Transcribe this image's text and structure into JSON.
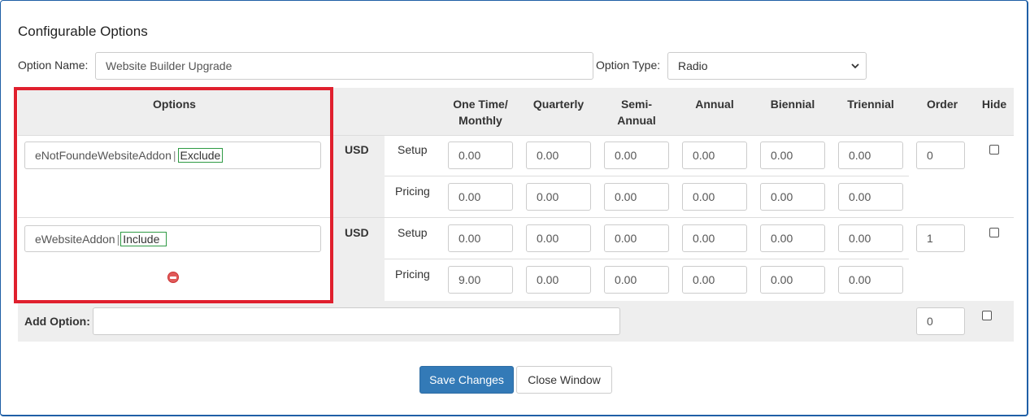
{
  "title": "Configurable Options",
  "option_name": {
    "label": "Option Name:",
    "value": "Website Builder Upgrade"
  },
  "option_type": {
    "label": "Option Type:",
    "value": "Radio"
  },
  "headers": {
    "options": "Options",
    "one_time_l1": "One Time/",
    "one_time_l2": "Monthly",
    "quarterly": "Quarterly",
    "semi_l1": "Semi-",
    "semi_l2": "Annual",
    "annual": "Annual",
    "biennial": "Biennial",
    "triennial": "Triennial",
    "order": "Order",
    "hide": "Hide"
  },
  "rows": [
    {
      "name_prefix": "eNotFoundeWebsiteAddon",
      "name_suffix": "Exclude",
      "currency": "USD",
      "setup_label": "Setup",
      "pricing_label": "Pricing",
      "setup": [
        "0.00",
        "0.00",
        "0.00",
        "0.00",
        "0.00",
        "0.00"
      ],
      "pricing": [
        "0.00",
        "0.00",
        "0.00",
        "0.00",
        "0.00",
        "0.00"
      ],
      "order": "0",
      "hide": false
    },
    {
      "name_prefix": "eWebsiteAddon",
      "name_suffix": "Include",
      "currency": "USD",
      "setup_label": "Setup",
      "pricing_label": "Pricing",
      "setup": [
        "0.00",
        "0.00",
        "0.00",
        "0.00",
        "0.00",
        "0.00"
      ],
      "pricing": [
        "9.00",
        "0.00",
        "0.00",
        "0.00",
        "0.00",
        "0.00"
      ],
      "order": "1",
      "hide": false
    }
  ],
  "add_option": {
    "label": "Add Option:",
    "value": "",
    "order": "0",
    "hide": false
  },
  "buttons": {
    "save": "Save Changes",
    "close": "Close Window"
  },
  "colors": {
    "highlight_box": "#e0202e",
    "primary": "#337ab7",
    "tag_outline": "#2e9a44",
    "remove_icon": "#e05a5a"
  }
}
